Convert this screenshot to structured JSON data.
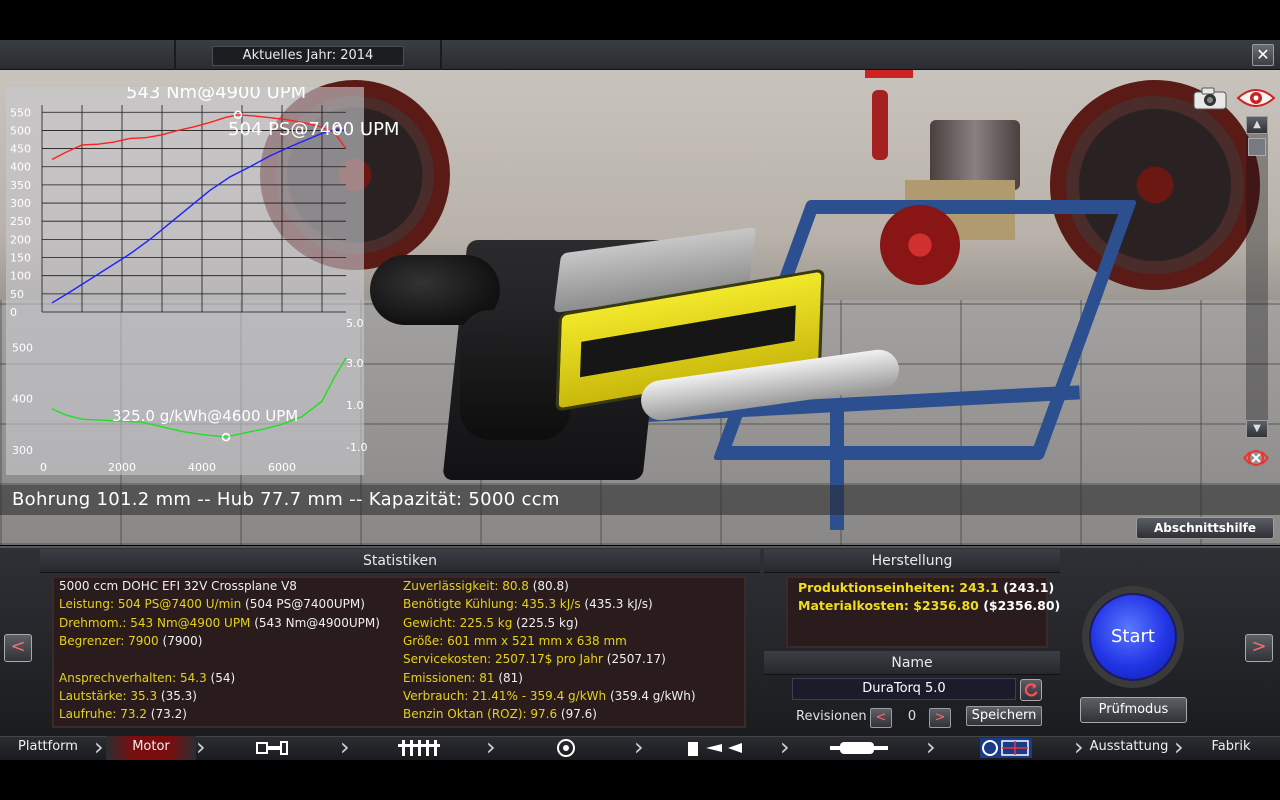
{
  "header": {
    "year_label": "Aktuelles Jahr: 2014",
    "close_label": "✕"
  },
  "chart_data": [
    {
      "type": "line",
      "title": "",
      "ylim": [
        0,
        570
      ],
      "xlim": [
        0,
        7600
      ],
      "y_ticks": [
        "550",
        "500",
        "450",
        "400",
        "350",
        "300",
        "250",
        "200",
        "150",
        "100",
        "50",
        "0"
      ],
      "annotations": [
        "543 Nm@4900 UPM",
        "504 PS@7400 UPM"
      ],
      "series": [
        {
          "color": "#ff2020",
          "x": [
            250,
            600,
            1000,
            1400,
            1800,
            2200,
            2600,
            3000,
            3400,
            3800,
            4200,
            4600,
            4900,
            5300,
            5700,
            6100,
            6500,
            6900,
            7300,
            7600
          ],
          "y": [
            420,
            440,
            460,
            462,
            468,
            478,
            480,
            488,
            500,
            510,
            522,
            536,
            543,
            540,
            535,
            530,
            522,
            512,
            495,
            450
          ]
        },
        {
          "color": "#2020ff",
          "x": [
            250,
            700,
            1200,
            1700,
            2200,
            2700,
            3200,
            3700,
            4200,
            4700,
            5200,
            5700,
            6200,
            6700,
            7000,
            7400,
            7600
          ],
          "y": [
            25,
            55,
            90,
            125,
            160,
            200,
            245,
            290,
            335,
            372,
            400,
            430,
            455,
            478,
            492,
            504,
            498
          ]
        }
      ]
    },
    {
      "type": "line",
      "x_ticks": [
        "0",
        "2000",
        "4000",
        "6000"
      ],
      "y_ticks_left": [
        "500",
        "400",
        "300"
      ],
      "y_ticks_right": [
        "5.0",
        "3.0",
        "1.0",
        "-1.0"
      ],
      "annotations": [
        "325.0 g/kWh@4600 UPM"
      ],
      "ylim": [
        290,
        540
      ],
      "xlim": [
        0,
        7600
      ],
      "series": [
        {
          "color": "#20e020",
          "x": [
            250,
            600,
            1000,
            1500,
            2000,
            2500,
            3000,
            3500,
            4000,
            4600,
            5000,
            5500,
            6000,
            6500,
            7000,
            7300,
            7600
          ],
          "y": [
            380,
            368,
            360,
            358,
            356,
            354,
            345,
            336,
            330,
            325,
            332,
            340,
            350,
            365,
            395,
            440,
            480
          ]
        }
      ]
    }
  ],
  "specs_line": "Bohrung 101.2 mm -- Hub 77.7 mm -- Kapazität: 5000 ccm",
  "help_button": "Abschnittshilfe",
  "icons": {
    "camera": "camera-icon",
    "eye": "eye-icon",
    "scroll_up": "▲",
    "scroll_down": "▼",
    "target": "target-icon"
  },
  "stats": {
    "title": "Statistiken",
    "left": [
      {
        "label": "5000 ccm DOHC EFI 32V Crossplane V8",
        "value": ""
      },
      {
        "label": "Leistung: 504 PS@7400 U/min",
        "value": "(504 PS@7400UPM)"
      },
      {
        "label": "Drehmom.: 543 Nm@4900 UPM",
        "value": "(543 Nm@4900UPM)"
      },
      {
        "label": "Begrenzer: 7900",
        "value": "(7900)"
      },
      {
        "label": "",
        "value": ""
      },
      {
        "label": "Ansprechverhalten: 54.3",
        "value": "(54)"
      },
      {
        "label": "Lautstärke: 35.3",
        "value": "(35.3)"
      },
      {
        "label": "Laufruhe: 73.2",
        "value": "(73.2)"
      }
    ],
    "right": [
      {
        "label": "Zuverlässigkeit: 80.8",
        "value": "(80.8)"
      },
      {
        "label": "Benötigte Kühlung: 435.3 kJ/s",
        "value": "(435.3 kJ/s)"
      },
      {
        "label": "Gewicht: 225.5 kg",
        "value": "(225.5 kg)"
      },
      {
        "label": "Größe: 601 mm x 521 mm x 638 mm",
        "value": ""
      },
      {
        "label": "Servicekosten: 2507.17$ pro Jahr",
        "value": "(2507.17)"
      },
      {
        "label": "Emissionen: 81",
        "value": "(81)"
      },
      {
        "label": "Verbrauch: 21.41% - 359.4 g/kWh",
        "value": "(359.4 g/kWh)"
      },
      {
        "label": "Benzin Oktan (ROZ): 97.6",
        "value": "(97.6)"
      }
    ]
  },
  "production": {
    "title": "Herstellung",
    "units_label": "Produktionseinheiten: 243.1",
    "units_value": "(243.1)",
    "material_label": "Materialkosten: $2356.80",
    "material_value": "($2356.80)"
  },
  "name_section": {
    "title": "Name",
    "name_value": "DuraTorq 5.0",
    "revisions_label": "Revisionen",
    "revision_value": "0",
    "save_label": "Speichern",
    "prev": "<",
    "next": ">"
  },
  "actions": {
    "start": "Start",
    "test_mode": "Prüfmodus",
    "left_arrow": "<",
    "right_arrow": ">"
  },
  "nav": {
    "items": [
      "Plattform",
      "Motor",
      "Ausstattung",
      "Fabrik"
    ],
    "active": "Motor"
  },
  "colors": {
    "accent_yellow": "#e6d11a",
    "torque": "#ff2020",
    "power": "#2020ff",
    "consumption": "#20e020",
    "start_blue": "#2235e6",
    "nav_active": "#8a1010"
  }
}
